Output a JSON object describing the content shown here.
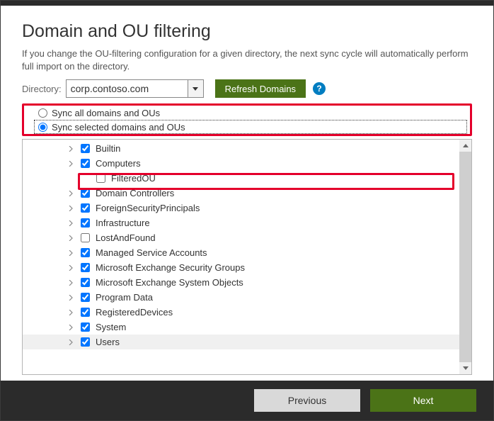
{
  "heading": "Domain and OU filtering",
  "description": "If you change the OU-filtering configuration for a given directory, the next sync cycle will automatically perform full import on the directory.",
  "directory": {
    "label": "Directory:",
    "value": "corp.contoso.com"
  },
  "refresh_label": "Refresh Domains",
  "help_glyph": "?",
  "sync_options": {
    "all": "Sync all domains and OUs",
    "selected": "Sync selected domains and OUs"
  },
  "tree": [
    {
      "label": "Builtin",
      "checked": true,
      "expandable": true,
      "indent": 1
    },
    {
      "label": "Computers",
      "checked": true,
      "expandable": true,
      "indent": 1
    },
    {
      "label": "FilteredOU",
      "checked": false,
      "expandable": false,
      "indent": 2,
      "highlight": true
    },
    {
      "label": "Domain Controllers",
      "checked": true,
      "expandable": true,
      "indent": 1
    },
    {
      "label": "ForeignSecurityPrincipals",
      "checked": true,
      "expandable": true,
      "indent": 1
    },
    {
      "label": "Infrastructure",
      "checked": true,
      "expandable": true,
      "indent": 1
    },
    {
      "label": "LostAndFound",
      "checked": false,
      "expandable": true,
      "indent": 1
    },
    {
      "label": "Managed Service Accounts",
      "checked": true,
      "expandable": true,
      "indent": 1
    },
    {
      "label": "Microsoft Exchange Security Groups",
      "checked": true,
      "expandable": true,
      "indent": 1
    },
    {
      "label": "Microsoft Exchange System Objects",
      "checked": true,
      "expandable": true,
      "indent": 1
    },
    {
      "label": "Program Data",
      "checked": true,
      "expandable": true,
      "indent": 1
    },
    {
      "label": "RegisteredDevices",
      "checked": true,
      "expandable": true,
      "indent": 1
    },
    {
      "label": "System",
      "checked": true,
      "expandable": true,
      "indent": 1
    },
    {
      "label": "Users",
      "checked": true,
      "expandable": true,
      "indent": 1
    }
  ],
  "buttons": {
    "prev": "Previous",
    "next": "Next"
  }
}
